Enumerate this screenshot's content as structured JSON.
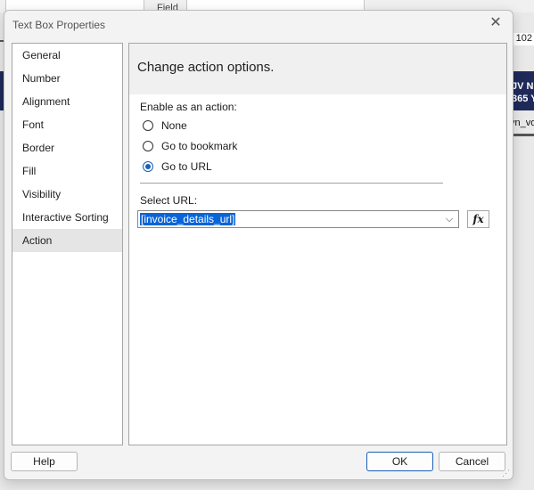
{
  "background": {
    "field_label": "Field",
    "right_number": "102",
    "navy_text_line1": "JV Nc",
    "navy_text_line2": "365 Y",
    "field_text": "yn_vo"
  },
  "dialog": {
    "title": "Text Box Properties",
    "close_icon": "close-icon"
  },
  "sidebar": {
    "items": [
      {
        "label": "General"
      },
      {
        "label": "Number"
      },
      {
        "label": "Alignment"
      },
      {
        "label": "Font"
      },
      {
        "label": "Border"
      },
      {
        "label": "Fill"
      },
      {
        "label": "Visibility"
      },
      {
        "label": "Interactive Sorting"
      },
      {
        "label": "Action",
        "selected": true
      }
    ]
  },
  "content": {
    "heading": "Change action options.",
    "enable_label": "Enable as an action:",
    "options": [
      {
        "label": "None",
        "checked": false
      },
      {
        "label": "Go to bookmark",
        "checked": false
      },
      {
        "label": "Go to URL",
        "checked": true
      }
    ],
    "select_url_label": "Select URL:",
    "url_value": "[invoice_details_url]",
    "fx_label": "fx"
  },
  "buttons": {
    "help": "Help",
    "ok": "OK",
    "cancel": "Cancel"
  },
  "colors": {
    "accent": "#1a5fb4",
    "selection": "#0a64d6",
    "navy": "#1f2a5a"
  }
}
